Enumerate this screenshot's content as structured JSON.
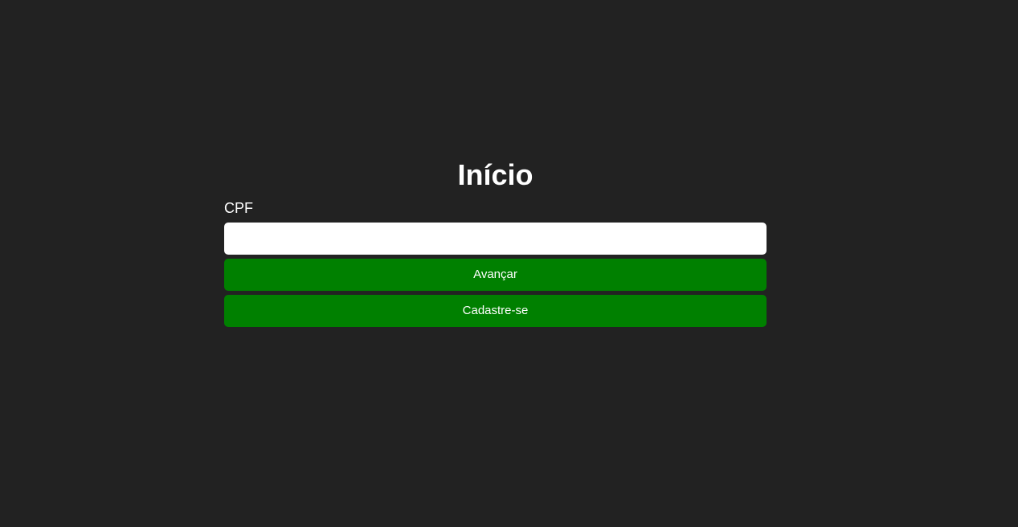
{
  "page": {
    "title": "Início"
  },
  "form": {
    "cpf_label": "CPF",
    "cpf_value": "",
    "advance_label": "Avançar",
    "register_label": "Cadastre-se"
  },
  "colors": {
    "background": "#222222",
    "button": "#008000",
    "text": "#ffffff",
    "input_background": "#ffffff"
  }
}
